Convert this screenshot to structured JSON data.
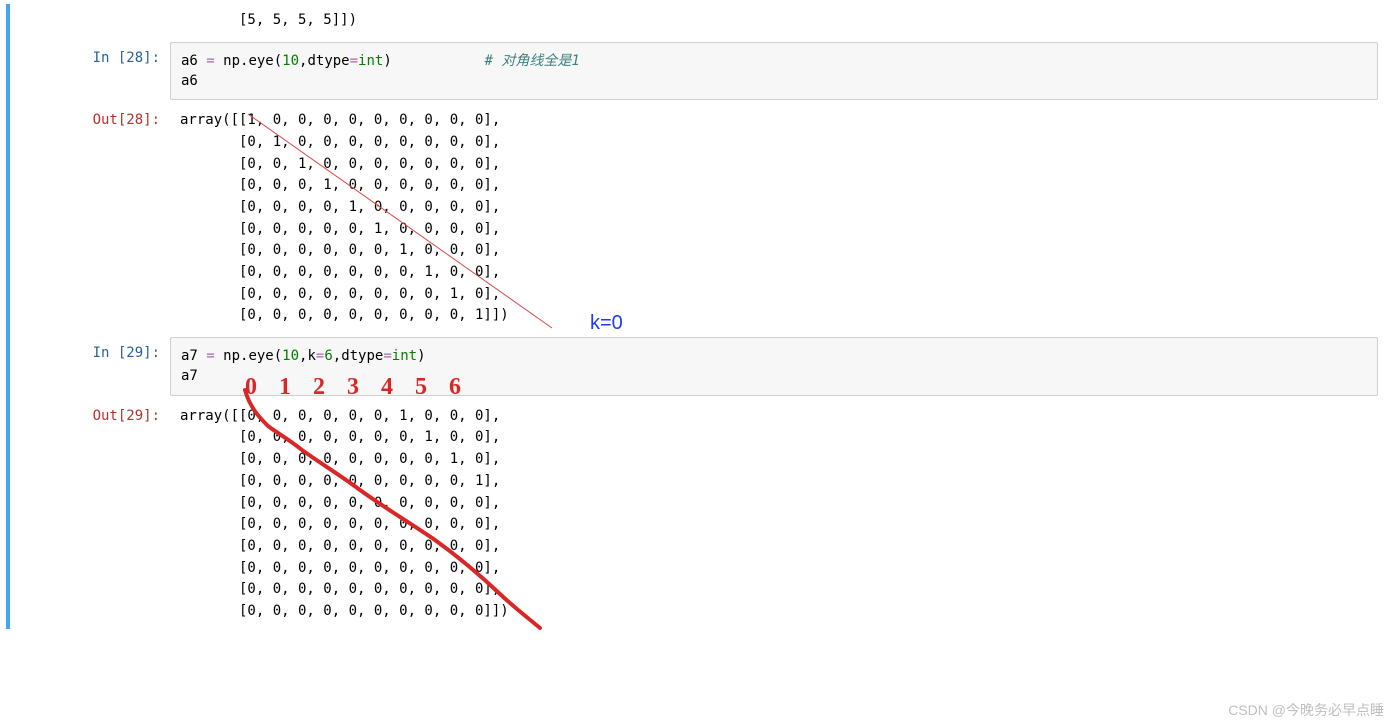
{
  "cells": {
    "top_fragment": {
      "output": "       [5, 5, 5, 5]])"
    },
    "in28": {
      "prompt": "In  [28]:",
      "code_plain": "a6 = np.eye(10,dtype=int)           # 对角线全是1\na6",
      "a_var": "a6 ",
      "eq": "= ",
      "np_txt": "np.eye(",
      "ten": "10",
      "comma_dtype": ",dtype",
      "eq2": "=",
      "int_kw": "int",
      "close": ")           ",
      "comment": "# 对角线全是1",
      "line2": "a6"
    },
    "out28": {
      "prompt": "Out[28]:",
      "output": "array([[1, 0, 0, 0, 0, 0, 0, 0, 0, 0],\n       [0, 1, 0, 0, 0, 0, 0, 0, 0, 0],\n       [0, 0, 1, 0, 0, 0, 0, 0, 0, 0],\n       [0, 0, 0, 1, 0, 0, 0, 0, 0, 0],\n       [0, 0, 0, 0, 1, 0, 0, 0, 0, 0],\n       [0, 0, 0, 0, 0, 1, 0, 0, 0, 0],\n       [0, 0, 0, 0, 0, 0, 1, 0, 0, 0],\n       [0, 0, 0, 0, 0, 0, 0, 1, 0, 0],\n       [0, 0, 0, 0, 0, 0, 0, 0, 1, 0],\n       [0, 0, 0, 0, 0, 0, 0, 0, 0, 1]])"
    },
    "in29": {
      "prompt": "In  [29]:",
      "code_plain": "a7 = np.eye(10,k=6,dtype=int)\na7",
      "a_var": "a7 ",
      "eq": "= ",
      "np_txt": "np.eye(",
      "ten": "10",
      "comma_k": ",k",
      "eq2": "=",
      "six": "6",
      "comma_dtype": ",dtype",
      "eq3": "=",
      "int_kw": "int",
      "close": ")",
      "line2": "a7"
    },
    "out29": {
      "prompt": "Out[29]:",
      "output": "array([[0, 0, 0, 0, 0, 0, 1, 0, 0, 0],\n       [0, 0, 0, 0, 0, 0, 0, 1, 0, 0],\n       [0, 0, 0, 0, 0, 0, 0, 0, 1, 0],\n       [0, 0, 0, 0, 0, 0, 0, 0, 0, 1],\n       [0, 0, 0, 0, 0, 0, 0, 0, 0, 0],\n       [0, 0, 0, 0, 0, 0, 0, 0, 0, 0],\n       [0, 0, 0, 0, 0, 0, 0, 0, 0, 0],\n       [0, 0, 0, 0, 0, 0, 0, 0, 0, 0],\n       [0, 0, 0, 0, 0, 0, 0, 0, 0, 0],\n       [0, 0, 0, 0, 0, 0, 0, 0, 0, 0]])"
    }
  },
  "annotations": {
    "k0": "k=0",
    "hand_digits": "0 1 2 3 4 5 6"
  },
  "watermark": "CSDN @今晚务必早点睡"
}
